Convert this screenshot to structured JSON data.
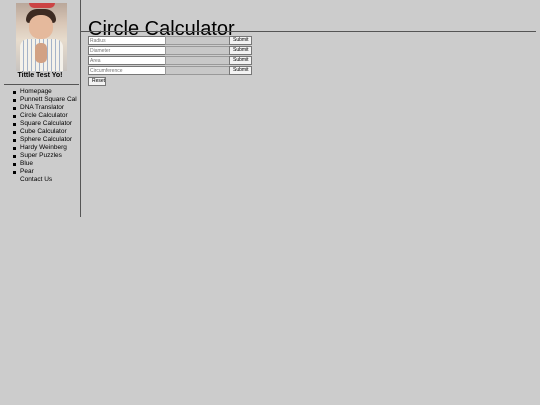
{
  "sidebar": {
    "site_title": "Tittle Test Yo!",
    "nav": [
      {
        "label": "Homepage"
      },
      {
        "label": "Punnett Square Cal"
      },
      {
        "label": "DNA Translator"
      },
      {
        "label": "Circle Calculator"
      },
      {
        "label": "Square Calculator"
      },
      {
        "label": "Cube Calculator"
      },
      {
        "label": "Sphere Calculator"
      },
      {
        "label": "Hardy Weinberg"
      },
      {
        "label": "Super Puzzles"
      },
      {
        "label": "Blue"
      },
      {
        "label": "Pear"
      },
      {
        "label": "Contact Us"
      }
    ]
  },
  "main": {
    "title": "Circle Calculator",
    "fields": [
      {
        "placeholder": "Radius",
        "value": "",
        "result": "",
        "button": "Submit"
      },
      {
        "placeholder": "Diameter",
        "value": "",
        "result": "",
        "button": "Submit"
      },
      {
        "placeholder": "Area",
        "value": "",
        "result": "",
        "button": "Submit"
      },
      {
        "placeholder": "Circumference",
        "value": "",
        "result": "",
        "button": "Submit"
      }
    ],
    "reset_label": "Reset"
  }
}
